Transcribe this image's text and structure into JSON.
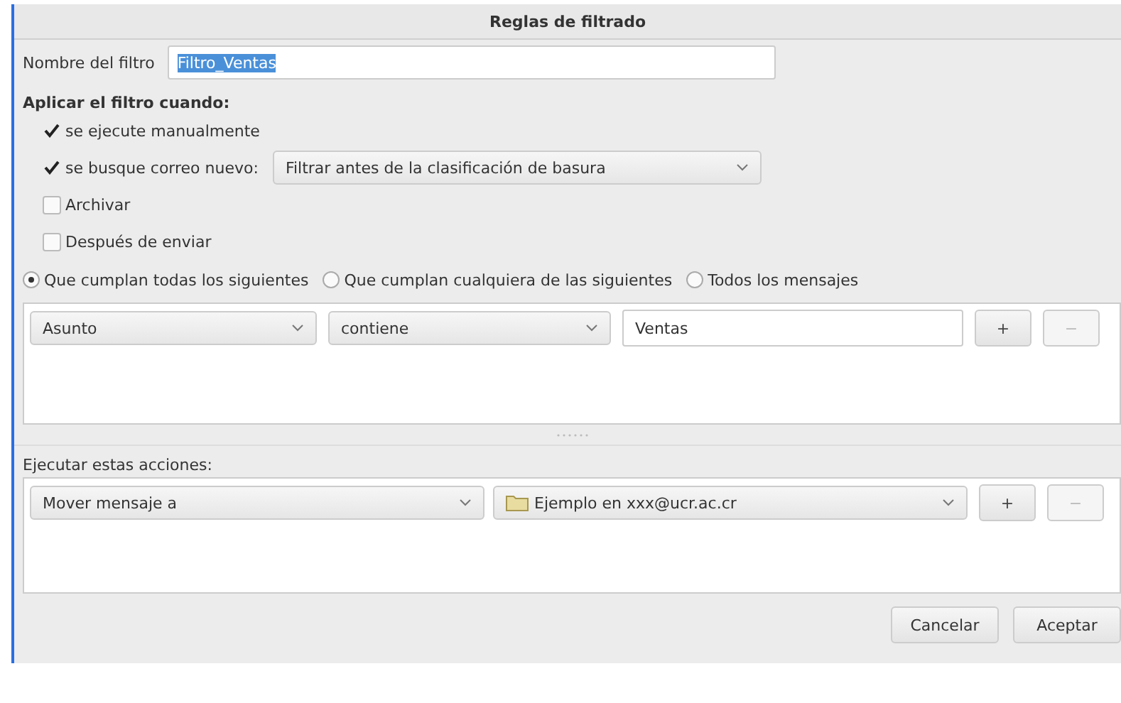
{
  "window": {
    "title": "Reglas de filtrado"
  },
  "filter_name": {
    "label": "Nombre del filtro",
    "value": "Filtro_Ventas"
  },
  "apply_when": {
    "heading": "Aplicar el filtro cuando:",
    "options": [
      {
        "kind": "checkbox",
        "label": "se ejecute manualmente",
        "checked": true
      },
      {
        "kind": "checkbox-select",
        "label": "se busque correo nuevo:",
        "checked": true,
        "select": "Filtrar antes de la clasificación de basura"
      },
      {
        "kind": "checkbox",
        "label": "Archivar",
        "checked": false
      },
      {
        "kind": "checkbox",
        "label": "Después de enviar",
        "checked": false
      }
    ]
  },
  "match": [
    {
      "label": "Que cumplan todas los siguientes",
      "selected": true
    },
    {
      "label": "Que cumplan cualquiera de las siguientes",
      "selected": false
    },
    {
      "label": "Todos los mensajes",
      "selected": false
    }
  ],
  "conditions": [
    {
      "field": "Asunto",
      "operator": "contiene",
      "value": "Ventas",
      "add": "+",
      "remove": "−"
    }
  ],
  "actions_heading": "Ejecutar estas acciones:",
  "actions": [
    {
      "action": "Mover mensaje a",
      "target": "Ejemplo en xxx@ucr.ac.cr",
      "add": "+",
      "remove": "−"
    }
  ],
  "buttons": [
    "Cancelar",
    "Aceptar"
  ]
}
